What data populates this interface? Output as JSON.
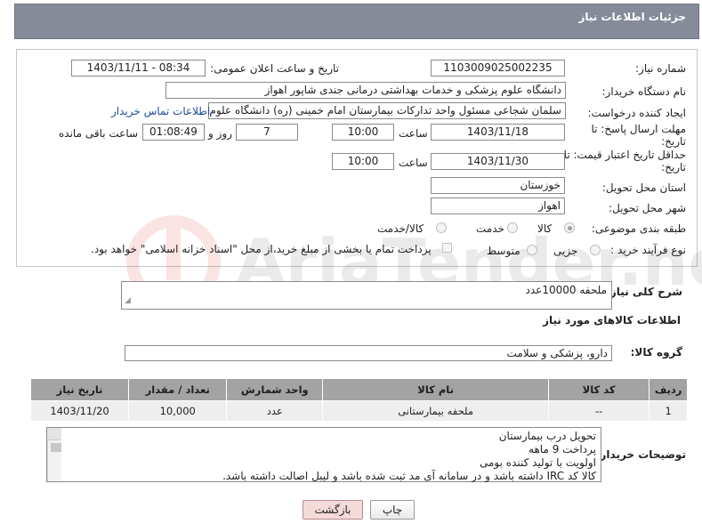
{
  "header": {
    "title": "جزئیات اطلاعات نیاز"
  },
  "need_number": {
    "label": "شماره نیاز:",
    "value": "1103009025002235"
  },
  "announce_datetime": {
    "label": "تاریخ و ساعت اعلان عمومی:",
    "value": "1403/11/11 - 08:34"
  },
  "buyer_org": {
    "label": "نام دستگاه خریدار:",
    "value": "دانشگاه علوم پزشکی و خدمات بهداشتی درمانی جندی شاپور اهواز"
  },
  "requester": {
    "label": "ایجاد کننده درخواست:",
    "value": "سلمان شجاعی مسئول واحد تدارکات بیمارستان امام خمینی (ره) دانشگاه علوم پزشکی",
    "contact_link": "اطلاعات تماس خریدار"
  },
  "reply_deadline": {
    "label_line1": "مهلت ارسال پاسخ: تا",
    "label_line2": "تاریخ:",
    "date": "1403/11/18",
    "time_label": "ساعت",
    "time": "10:00",
    "days": "7",
    "days_label": "روز و",
    "remaining": "01:08:49",
    "remaining_label": "ساعت باقی مانده"
  },
  "price_validity": {
    "label_line1": "حداقل تاریخ اعتبار قیمت: تا",
    "label_line2": "تاریخ:",
    "date": "1403/11/30",
    "time_label": "ساعت",
    "time": "10:00"
  },
  "delivery_province": {
    "label": "استان محل تحویل:",
    "value": "خوزستان"
  },
  "delivery_city": {
    "label": "شهر محل تحویل:",
    "value": "اهواز"
  },
  "category": {
    "label": "طبقه بندی موضوعی:",
    "options": [
      "کالا",
      "خدمت",
      "کالا/خدمت"
    ],
    "selected": "کالا"
  },
  "purchase_process": {
    "label": "نوع فرآیند خرید :",
    "options": [
      "جزیی",
      "متوسط"
    ],
    "payment_note": "پرداخت تمام یا بخشی از مبلغ خرید،از محل \"اسناد خزانه اسلامی\" خواهد بود."
  },
  "summary": {
    "label": "شرح کلی نیاز:",
    "value": "ملحفه   10000عدد"
  },
  "goods_info": {
    "title": "اطلاعات کالاهای مورد نیاز"
  },
  "goods_group": {
    "label": "گروه کالا:",
    "value": "دارو، پزشکی و سلامت"
  },
  "items_table": {
    "headers": [
      "ردیف",
      "کد کالا",
      "نام کالا",
      "واحد شمارش",
      "تعداد / مقدار",
      "تاریخ نیاز"
    ],
    "rows": [
      [
        "1",
        "--",
        "ملحفه بیمارستانی",
        "عدد",
        "10,000",
        "1403/11/20"
      ]
    ]
  },
  "buyer_notes": {
    "label": "توضیحات خریدار:",
    "lines": [
      "تحویل درب بیمارستان",
      "پرداخت 9 ماهه",
      "اولویت با تولید کننده بومی",
      "کالا کد IRC داشته باشد و در سامانه آی مد ثبت شده باشد و لیبل اصالت داشته باشد."
    ]
  },
  "buttons": {
    "print": "چاپ",
    "back": "بازگشت"
  }
}
